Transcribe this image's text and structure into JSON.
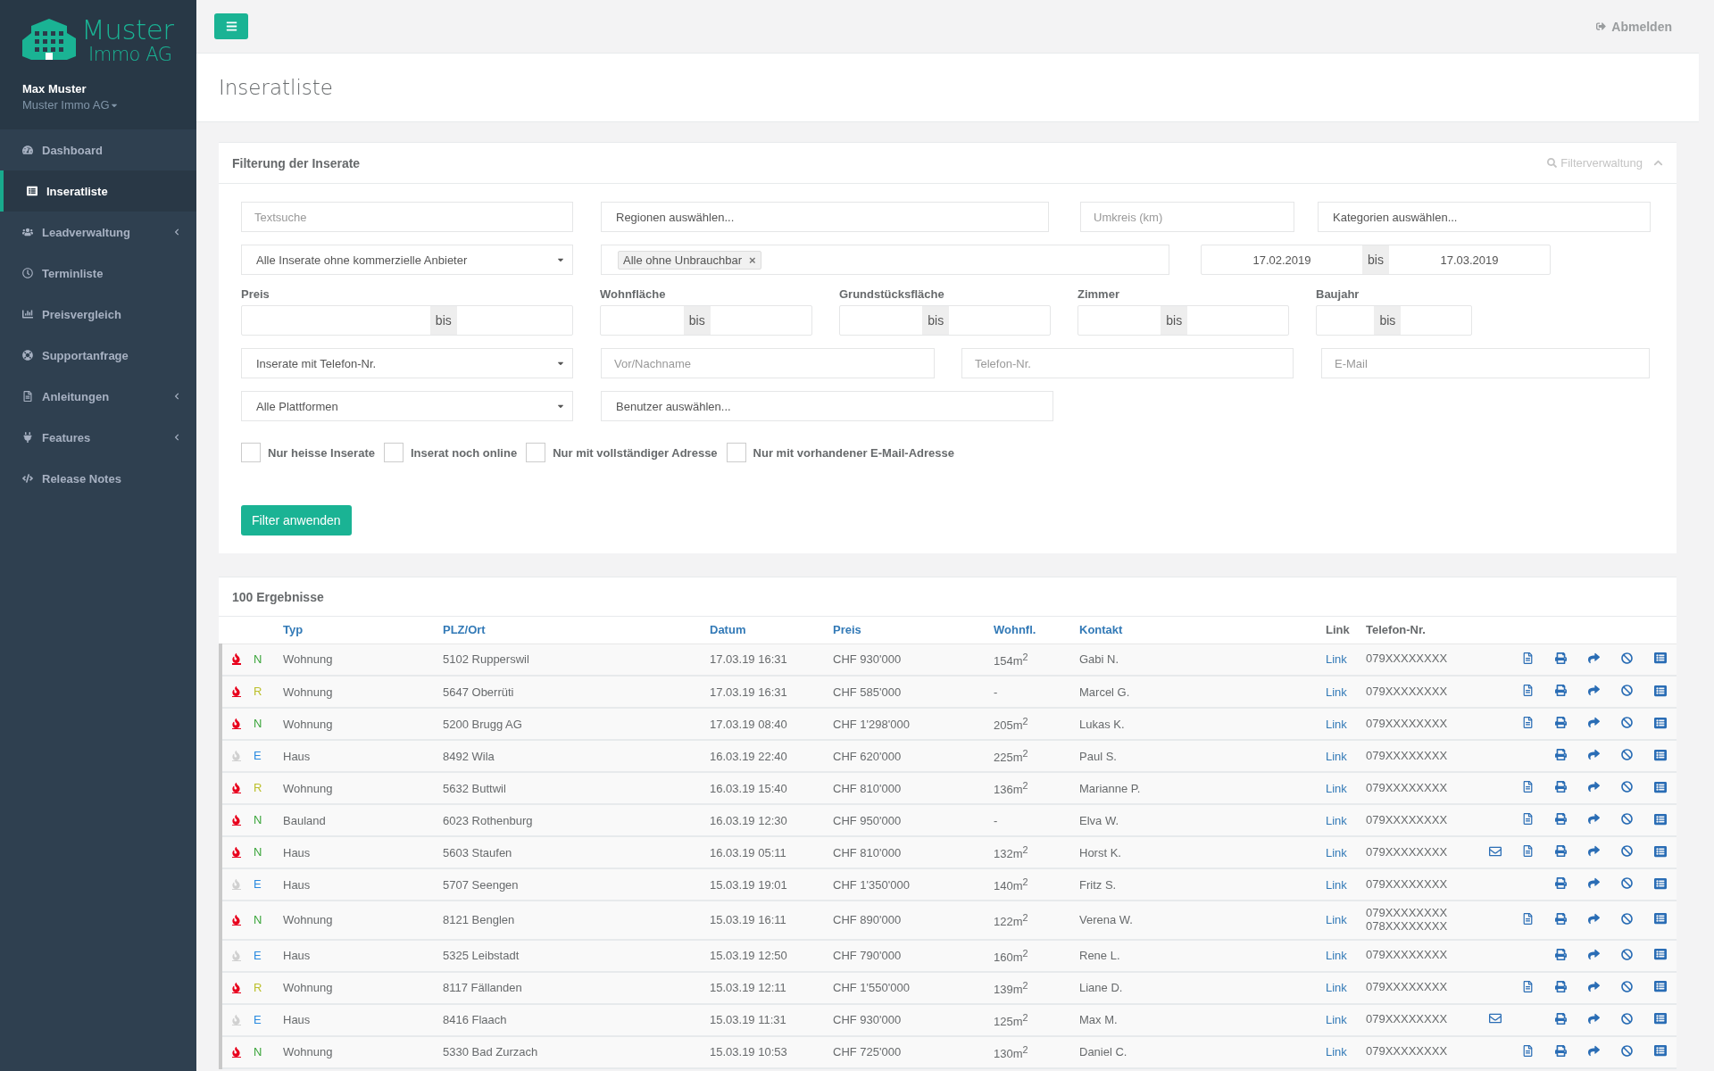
{
  "topbar": {
    "logout": "Abmelden"
  },
  "sidebar": {
    "brand": {
      "line1": "Muster",
      "line2": "Immo AG"
    },
    "user": {
      "name": "Max Muster",
      "company": "Muster Immo AG"
    },
    "items": [
      {
        "label": "Dashboard",
        "selected": false,
        "submenu": false
      },
      {
        "label": "Inseratliste",
        "selected": true,
        "submenu": false
      },
      {
        "label": "Leadverwaltung",
        "selected": false,
        "submenu": true
      },
      {
        "label": "Terminliste",
        "selected": false,
        "submenu": false
      },
      {
        "label": "Preisvergleich",
        "selected": false,
        "submenu": false
      },
      {
        "label": "Supportanfrage",
        "selected": false,
        "submenu": false
      },
      {
        "label": "Anleitungen",
        "selected": false,
        "submenu": true
      },
      {
        "label": "Features",
        "selected": false,
        "submenu": true
      },
      {
        "label": "Release Notes",
        "selected": false,
        "submenu": false
      }
    ]
  },
  "page_title": "Inseratliste",
  "filter": {
    "title": "Filterung der Inserate",
    "manager": "Filterverwaltung",
    "text_search": {
      "placeholder": "Textsuche"
    },
    "regions": {
      "prompt": "Regionen auswählen..."
    },
    "radius": {
      "placeholder": "Umkreis (km)"
    },
    "categories": {
      "prompt": "Kategorien auswählen..."
    },
    "provider_select": {
      "value": "Alle Inserate ohne kommerzielle Anbieter"
    },
    "status_tags": [
      {
        "label": "Alle ohne Unbrauchbar",
        "remove": "×"
      }
    ],
    "date_range": {
      "from": "17.02.2019",
      "separator": "bis",
      "to": "17.03.2019"
    },
    "ranges": [
      {
        "label": "Preis",
        "separator": "bis"
      },
      {
        "label": "Wohnfläche",
        "separator": "bis"
      },
      {
        "label": "Grundstücksfläche",
        "separator": "bis"
      },
      {
        "label": "Zimmer",
        "separator": "bis"
      },
      {
        "label": "Baujahr",
        "separator": "bis"
      }
    ],
    "phone_select": {
      "value": "Inserate mit Telefon-Nr."
    },
    "name": {
      "placeholder": "Vor/Nachname"
    },
    "phone": {
      "placeholder": "Telefon-Nr."
    },
    "email": {
      "placeholder": "E-Mail"
    },
    "platform_select": {
      "value": "Alle Plattformen"
    },
    "users": {
      "prompt": "Benutzer auswählen..."
    },
    "checkboxes": [
      {
        "label": "Nur heisse Inserate",
        "checked": false
      },
      {
        "label": "Inserat noch online",
        "checked": false
      },
      {
        "label": "Nur mit vollständiger Adresse",
        "checked": false
      },
      {
        "label": "Nur mit vorhandener E-Mail-Adresse",
        "checked": false
      }
    ],
    "apply_button": "Filter anwenden"
  },
  "results": {
    "title": "100 Ergebnisse",
    "columns": [
      {
        "label": "Typ",
        "sortable": true
      },
      {
        "label": "PLZ/Ort",
        "sortable": true
      },
      {
        "label": "Datum",
        "sortable": true
      },
      {
        "label": "Preis",
        "sortable": true
      },
      {
        "label": "Wohnfl.",
        "sortable": true
      },
      {
        "label": "Kontakt",
        "sortable": true
      },
      {
        "label": "Link",
        "sortable": false
      },
      {
        "label": "Telefon-Nr.",
        "sortable": false
      }
    ],
    "rows": [
      {
        "hot": true,
        "status": {
          "letter": "N",
          "color": "#3aa53a"
        },
        "type": "Wohnung",
        "location": "5102 Rupperswil",
        "date": "17.03.19 16:31",
        "price": "CHF 930'000",
        "area": "154m$^{2}$",
        "contact": "Gabi N.",
        "link": "Link",
        "phones": [
          "079XXXXXXXX"
        ],
        "mail": false,
        "document": true
      },
      {
        "hot": true,
        "status": {
          "letter": "R",
          "color": "#bcc02c"
        },
        "type": "Wohnung",
        "location": "5647 Oberrüti",
        "date": "17.03.19 16:31",
        "price": "CHF 585'000",
        "area": "-",
        "contact": "Marcel G.",
        "link": "Link",
        "phones": [
          "079XXXXXXXX"
        ],
        "mail": false,
        "document": true
      },
      {
        "hot": true,
        "status": {
          "letter": "N",
          "color": "#3aa53a"
        },
        "type": "Wohnung",
        "location": "5200 Brugg AG",
        "date": "17.03.19 08:40",
        "price": "CHF 1'298'000",
        "area": "205m$^{2}$",
        "contact": "Lukas K.",
        "link": "Link",
        "phones": [
          "079XXXXXXXX"
        ],
        "mail": false,
        "document": true
      },
      {
        "hot": false,
        "status": {
          "letter": "E",
          "color": "#2b8be0"
        },
        "type": "Haus",
        "location": "8492 Wila",
        "date": "16.03.19 22:40",
        "price": "CHF 620'000",
        "area": "225m$^{2}$",
        "contact": "Paul S.",
        "link": "Link",
        "phones": [
          "079XXXXXXXX"
        ],
        "mail": false,
        "document": false
      },
      {
        "hot": true,
        "status": {
          "letter": "R",
          "color": "#bcc02c"
        },
        "type": "Wohnung",
        "location": "5632 Buttwil",
        "date": "16.03.19 15:40",
        "price": "CHF 810'000",
        "area": "136m$^{2}$",
        "contact": "Marianne P.",
        "link": "Link",
        "phones": [
          "079XXXXXXXX"
        ],
        "mail": false,
        "document": true
      },
      {
        "hot": true,
        "status": {
          "letter": "N",
          "color": "#3aa53a"
        },
        "type": "Bauland",
        "location": "6023 Rothenburg",
        "date": "16.03.19 12:30",
        "price": "CHF 950'000",
        "area": "-",
        "contact": "Elva W.",
        "link": "Link",
        "phones": [
          "079XXXXXXXX"
        ],
        "mail": false,
        "document": true
      },
      {
        "hot": true,
        "status": {
          "letter": "N",
          "color": "#3aa53a"
        },
        "type": "Haus",
        "location": "5603 Staufen",
        "date": "16.03.19 05:11",
        "price": "CHF 810'000",
        "area": "132m$^{2}$",
        "contact": "Horst K.",
        "link": "Link",
        "phones": [
          "079XXXXXXXX"
        ],
        "mail": true,
        "document": true
      },
      {
        "hot": false,
        "status": {
          "letter": "E",
          "color": "#2b8be0"
        },
        "type": "Haus",
        "location": "5707 Seengen",
        "date": "15.03.19 19:01",
        "price": "CHF 1'350'000",
        "area": "140m$^{2}$",
        "contact": "Fritz S.",
        "link": "Link",
        "phones": [
          "079XXXXXXXX"
        ],
        "mail": false,
        "document": false
      },
      {
        "hot": true,
        "status": {
          "letter": "N",
          "color": "#3aa53a"
        },
        "type": "Wohnung",
        "location": "8121 Benglen",
        "date": "15.03.19 16:11",
        "price": "CHF 890'000",
        "area": "122m$^{2}$",
        "contact": "Verena W.",
        "link": "Link",
        "phones": [
          "079XXXXXXXX",
          "078XXXXXXXX"
        ],
        "mail": false,
        "document": true
      },
      {
        "hot": false,
        "status": {
          "letter": "E",
          "color": "#2b8be0"
        },
        "type": "Haus",
        "location": "5325 Leibstadt",
        "date": "15.03.19 12:50",
        "price": "CHF 790'000",
        "area": "160m$^{2}$",
        "contact": "Rene L.",
        "link": "Link",
        "phones": [
          "079XXXXXXXX"
        ],
        "mail": false,
        "document": false
      },
      {
        "hot": true,
        "status": {
          "letter": "R",
          "color": "#bcc02c"
        },
        "type": "Wohnung",
        "location": "8117 Fällanden",
        "date": "15.03.19 12:11",
        "price": "CHF 1'550'000",
        "area": "139m$^{2}$",
        "contact": "Liane D.",
        "link": "Link",
        "phones": [
          "079XXXXXXXX"
        ],
        "mail": false,
        "document": true
      },
      {
        "hot": false,
        "status": {
          "letter": "E",
          "color": "#2b8be0"
        },
        "type": "Haus",
        "location": "8416 Flaach",
        "date": "15.03.19 11:31",
        "price": "CHF 930'000",
        "area": "125m$^{2}$",
        "contact": "Max M.",
        "link": "Link",
        "phones": [
          "079XXXXXXXX"
        ],
        "mail": true,
        "document": false
      },
      {
        "hot": true,
        "status": {
          "letter": "N",
          "color": "#3aa53a"
        },
        "type": "Wohnung",
        "location": "5330 Bad Zurzach",
        "date": "15.03.19 10:53",
        "price": "CHF 725'000",
        "area": "130m$^{2}$",
        "contact": "Daniel C.",
        "link": "Link",
        "phones": [
          "079XXXXXXXX"
        ],
        "mail": false,
        "document": true
      }
    ]
  }
}
